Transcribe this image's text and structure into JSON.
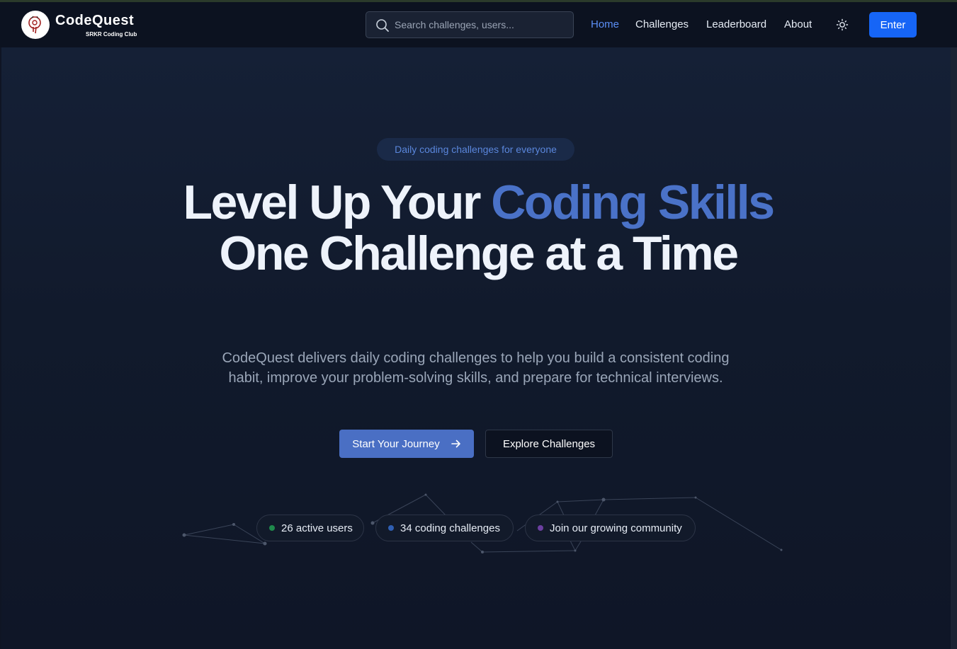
{
  "header": {
    "brand_title": "CodeQuest",
    "brand_subtitle": "SRKR Coding Club",
    "search_placeholder": "Search challenges, users...",
    "nav": [
      {
        "label": "Home",
        "active": true
      },
      {
        "label": "Challenges",
        "active": false
      },
      {
        "label": "Leaderboard",
        "active": false
      },
      {
        "label": "About",
        "active": false
      }
    ],
    "theme_toggle_icon": "sun-icon",
    "enter_label": "Enter"
  },
  "hero": {
    "badge": "Daily coding challenges for everyone",
    "headline_part1": "Level Up Your ",
    "headline_highlight": "Coding Skills",
    "headline_part2": " One Challenge at a Time",
    "description": "CodeQuest delivers daily coding challenges to help you build a consistent coding habit, improve your problem-solving skills, and prepare for technical interviews.",
    "primary_button": "Start Your Journey",
    "primary_button_icon": "arrow-right-icon",
    "secondary_button": "Explore Challenges"
  },
  "stats": [
    {
      "label": "26 active users",
      "dot_color": "#1f8a4c"
    },
    {
      "label": "34 coding challenges",
      "dot_color": "#2f5fb3"
    },
    {
      "label": "Join our growing community",
      "dot_color": "#6b3fa0"
    }
  ],
  "colors": {
    "accent": "#4a72c8",
    "enter_button": "#1665f6",
    "background": "#0f1524",
    "active_nav": "#5b8ef5"
  }
}
